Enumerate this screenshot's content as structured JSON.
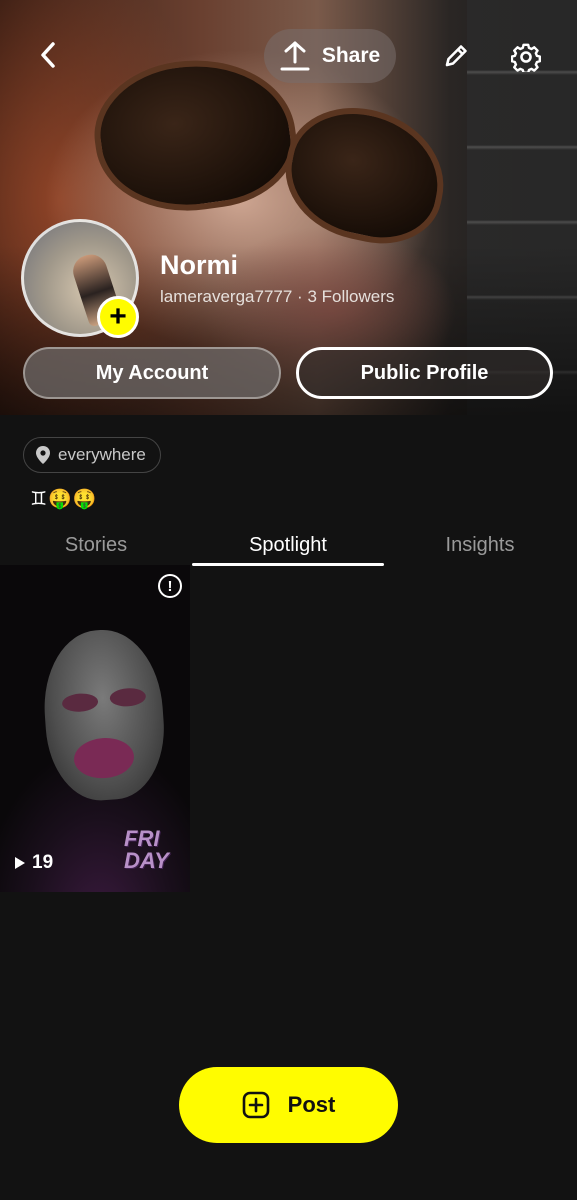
{
  "header": {
    "share_label": "Share",
    "icons": {
      "back": "chevron-left-icon",
      "share": "upload-icon",
      "edit": "pencil-icon",
      "settings": "gear-icon"
    }
  },
  "profile": {
    "display_name": "Normi",
    "username": "lameraverga7777",
    "separator": "·",
    "followers": "3 Followers",
    "add_badge": "+"
  },
  "actions": {
    "my_account": "My Account",
    "public_profile": "Public Profile"
  },
  "location": {
    "label": "everywhere"
  },
  "bio_emojis": "♊🤑🤑",
  "tabs": [
    {
      "label": "Stories",
      "active": false
    },
    {
      "label": "Spotlight",
      "active": true
    },
    {
      "label": "Insights",
      "active": false
    }
  ],
  "spotlight_tiles": [
    {
      "views": "19",
      "alert_symbol": "!",
      "sticker_text": "FRI DAY"
    }
  ],
  "post_button": {
    "label": "Post"
  },
  "colors": {
    "accent_yellow": "#fffc00",
    "background": "#121212",
    "inactive_tab": "#9a9a9a"
  }
}
